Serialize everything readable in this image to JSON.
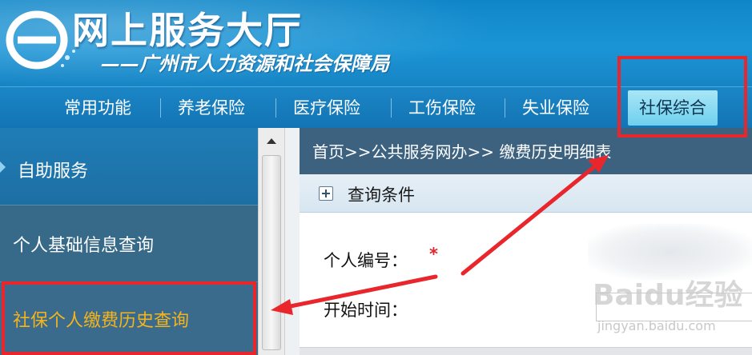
{
  "header": {
    "title": "网上服务大厅",
    "subtitle": "——广州市人力资源和社会保障局",
    "logo_icon": "e-logo-icon"
  },
  "nav": {
    "items": [
      {
        "label": "常用功能"
      },
      {
        "label": "养老保险"
      },
      {
        "label": "医疗保险"
      },
      {
        "label": "工伤保险"
      },
      {
        "label": "失业保险"
      },
      {
        "label": "社保综合",
        "active": true
      }
    ]
  },
  "sidebar": {
    "items": [
      {
        "label": "自助服务"
      },
      {
        "label": "个人基础信息查询"
      },
      {
        "label": "社保个人缴费历史查询",
        "highlighted": true
      }
    ]
  },
  "main": {
    "breadcrumb": "首页>>公共服务网办>> 缴费历史明细表",
    "section_title": "查询条件",
    "fields": [
      {
        "label": "个人编号：",
        "required_mark": "*"
      },
      {
        "label": "开始时间："
      }
    ]
  },
  "watermark": {
    "text": "Baidu经验",
    "url": "jingyan.baidu.com"
  },
  "colors": {
    "header_blue": "#1b95d6",
    "nav_active": "#6fd0ee",
    "highlight_text": "#f4b41a",
    "annotation_red": "#e8262c",
    "breadcrumb_bg": "#3d6280"
  }
}
